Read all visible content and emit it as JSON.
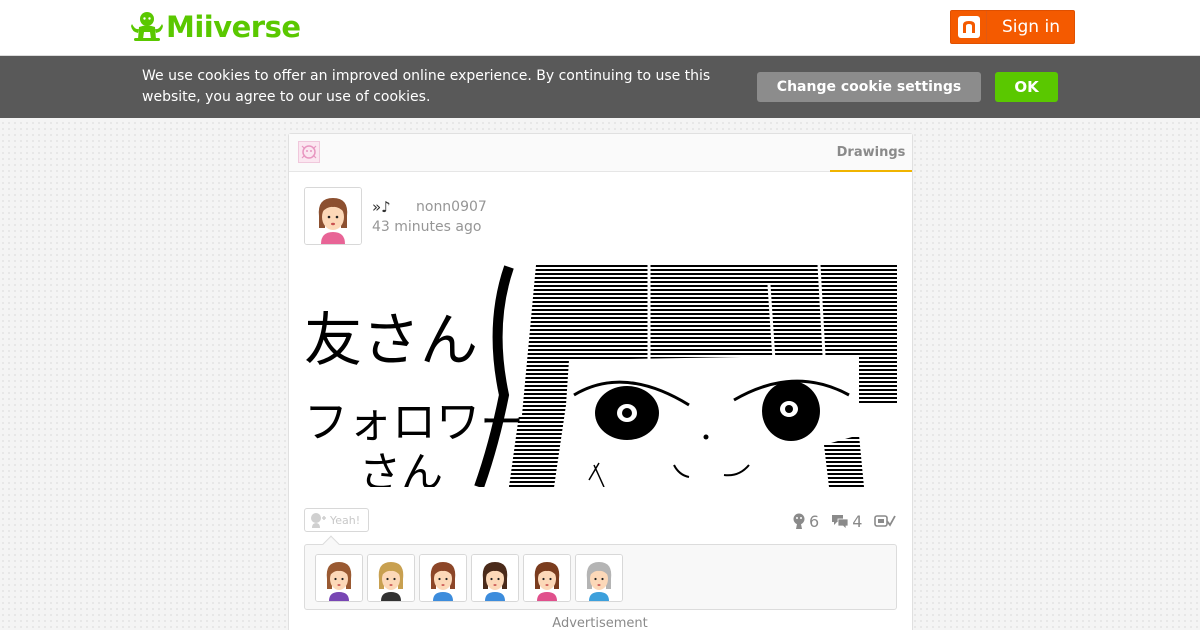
{
  "header": {
    "logo_text": "Miiverse",
    "signin_label": "Sign in",
    "colors": {
      "brand_green": "#5ac800",
      "signin_orange": "#f45a00"
    }
  },
  "cookie_bar": {
    "message": "We use cookies to offer an improved online experience. By continuing to use this website, you agree to our use of cookies.",
    "settings_label": "Change cookie settings",
    "ok_label": "OK"
  },
  "community": {
    "icon": "community-icon",
    "active_tab": "Drawings"
  },
  "post": {
    "screen_name": "»♪",
    "user_id": "nonn0907",
    "timestamp": "43 minutes ago",
    "drawing_text": [
      "友さん",
      "フォロワー",
      "さん"
    ],
    "yeah_label": "Yeah!",
    "yeah_count": "6",
    "comment_count": "4",
    "empathy_avatars": [
      {
        "name": "mii-avatar-1",
        "hair": "#9a5a32",
        "shirt": "#7846b4"
      },
      {
        "name": "mii-avatar-2",
        "hair": "#c8a050",
        "shirt": "#323232"
      },
      {
        "name": "mii-avatar-3",
        "hair": "#8c4628",
        "shirt": "#3c8cdc"
      },
      {
        "name": "mii-avatar-4",
        "hair": "#4a2a1a",
        "shirt": "#3c8cdc"
      },
      {
        "name": "mii-avatar-5",
        "hair": "#7a3c1e",
        "shirt": "#e0508c"
      },
      {
        "name": "mii-avatar-6",
        "hair": "#b4b4b4",
        "shirt": "#3ca0dc"
      }
    ]
  },
  "footer": {
    "ad_label": "Advertisement"
  }
}
